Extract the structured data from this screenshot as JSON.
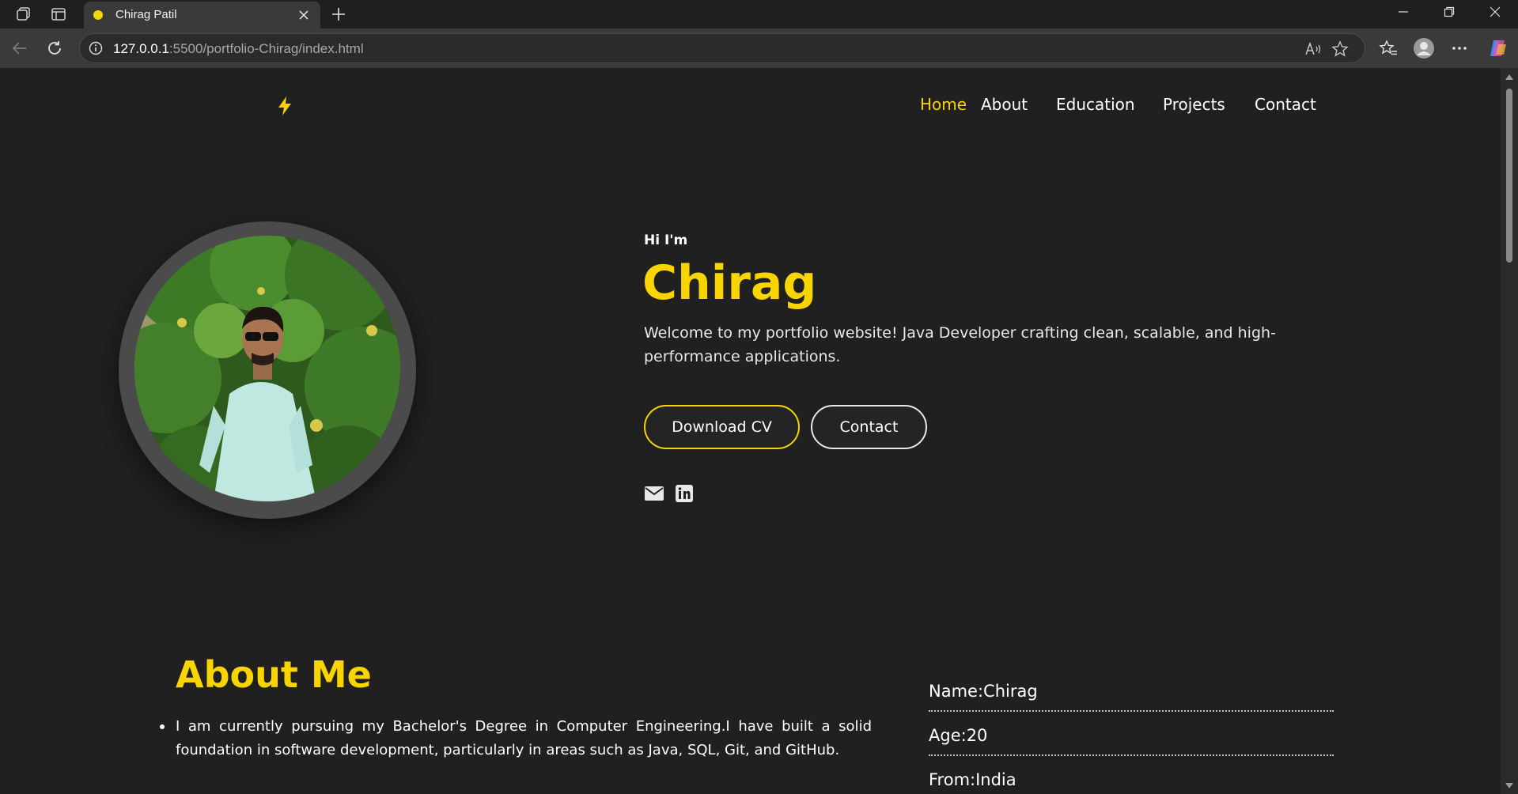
{
  "browser": {
    "tab_title": "Chirag Patil",
    "url_host": "127.0.0.1",
    "url_rest": ":5500/portfolio-Chirag/index.html",
    "icons": [
      "workspaces-icon",
      "tab-actions-icon",
      "close-icon",
      "new-tab-icon",
      "minimize-icon",
      "restore-icon",
      "window-close-icon",
      "back-icon",
      "refresh-icon",
      "site-info-icon",
      "read-aloud-icon",
      "favorite-star-icon",
      "favorites-icon",
      "profile-icon",
      "more-icon",
      "copilot-icon"
    ]
  },
  "site": {
    "accent": "#f8d400",
    "logo_icon": "lightning-bolt-icon",
    "nav": [
      {
        "label": "Home",
        "active": true
      },
      {
        "label": "About"
      },
      {
        "label": "Education"
      },
      {
        "label": "Projects"
      },
      {
        "label": "Contact"
      }
    ],
    "hero": {
      "greeting": "Hi I'm",
      "name": "Chirag",
      "welcome": "Welcome to my portfolio website! Java Developer crafting clean, scalable, and high-performance applications.",
      "download_cv": "Download CV",
      "contact": "Contact",
      "social_icons": [
        "email-icon",
        "linkedin-icon"
      ]
    },
    "about": {
      "title": "About Me",
      "items": [
        "I am currently pursuing my Bachelor's Degree in Computer Engineering.I have built a solid foundation in software development, particularly in areas such as Java, SQL, Git, and GitHub."
      ],
      "info": [
        "Name:Chirag",
        "Age:20",
        "From:India"
      ]
    }
  }
}
